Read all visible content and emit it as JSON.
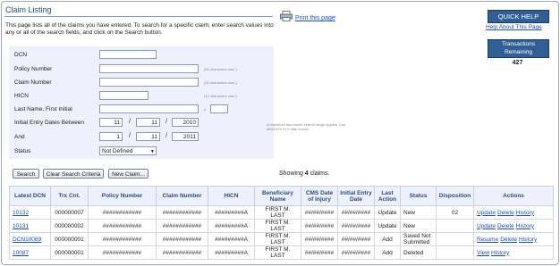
{
  "page": {
    "title": "Claim Listing",
    "print_link": "Print this page",
    "intro": "This page lists all of the claims you have entered. To search for a specific claim, enter search values into any or all of the search fields, and click on the Search button."
  },
  "sidebar": {
    "quick_help": "QUICK HELP",
    "help_link": "Help About This Page",
    "transactions_label": "Transactions Remaining",
    "transactions_count": "427"
  },
  "form": {
    "dcn_label": "DCN",
    "policy_label": "Policy Number",
    "policy_hint": "(30 characters max.)",
    "claim_label": "Claim Number",
    "claim_hint": "(30 characters max.)",
    "hicn_label": "HICN",
    "hicn_hint": "(12 characters max.)",
    "name_label": "Last Name, First Initial",
    "name_comma": ",",
    "between_label": "Initial Entry Dates Between",
    "from_month": "11",
    "from_day": "11",
    "from_year": "2010",
    "and_label": "And",
    "to_month": "1",
    "to_day": "11",
    "to_year": "2011",
    "date_hint": "A maximum two-month search range applies. Use MM/DD/YYYY date format.",
    "status_label": "Status",
    "status_value": "Not Defined",
    "slash": "/"
  },
  "buttons": {
    "search": "Search",
    "clear": "Clear Search Criteria",
    "new_claim": "New Claim..."
  },
  "results": {
    "showing_prefix": "Showing",
    "count": "4",
    "showing_suffix": "claims."
  },
  "table": {
    "headers": [
      "Latest DCN",
      "Trx Cnt.",
      "Policy Number",
      "Claim Number",
      "HICN",
      "Beneficiary Name",
      "CMS Date of Injury",
      "Initial Entry Date",
      "Last Action",
      "Status",
      "Disposition",
      "Actions"
    ],
    "rows": [
      {
        "dcn": "10132",
        "trx": "000000007",
        "policy": "############",
        "claim": "############",
        "hicn": "#########A",
        "name": "FIRST M. LAST",
        "injury": "##/##/####",
        "entry": "##/##/####",
        "action": "Update",
        "status": "New",
        "disposition": "02",
        "actions": [
          "Update",
          "Delete",
          "History"
        ]
      },
      {
        "dcn": "10131",
        "trx": "000000002",
        "policy": "############",
        "claim": "############",
        "hicn": "#########A",
        "name": "FIRST M. LAST",
        "injury": "##/##/####",
        "entry": "##/##/####",
        "action": "Update",
        "status": "New",
        "disposition": "",
        "actions": [
          "Update",
          "Delete",
          "History"
        ]
      },
      {
        "dcn": "DCN10089",
        "trx": "000000001",
        "policy": "############",
        "claim": "############",
        "hicn": "#########A",
        "name": "FIRST M. LAST",
        "injury": "##/##/####",
        "entry": "##/##/####",
        "action": "Add",
        "status": "Saved Not Submitted",
        "disposition": "",
        "actions": [
          "Resume",
          "Delete",
          "History"
        ]
      },
      {
        "dcn": "10087",
        "trx": "000000001",
        "policy": "############",
        "claim": "############",
        "hicn": "#########A",
        "name": "FIRST M. LAST",
        "injury": "##/##/####",
        "entry": "##/##/####",
        "action": "Add",
        "status": "Deleted",
        "disposition": "",
        "actions": [
          "View",
          "History"
        ]
      }
    ]
  }
}
